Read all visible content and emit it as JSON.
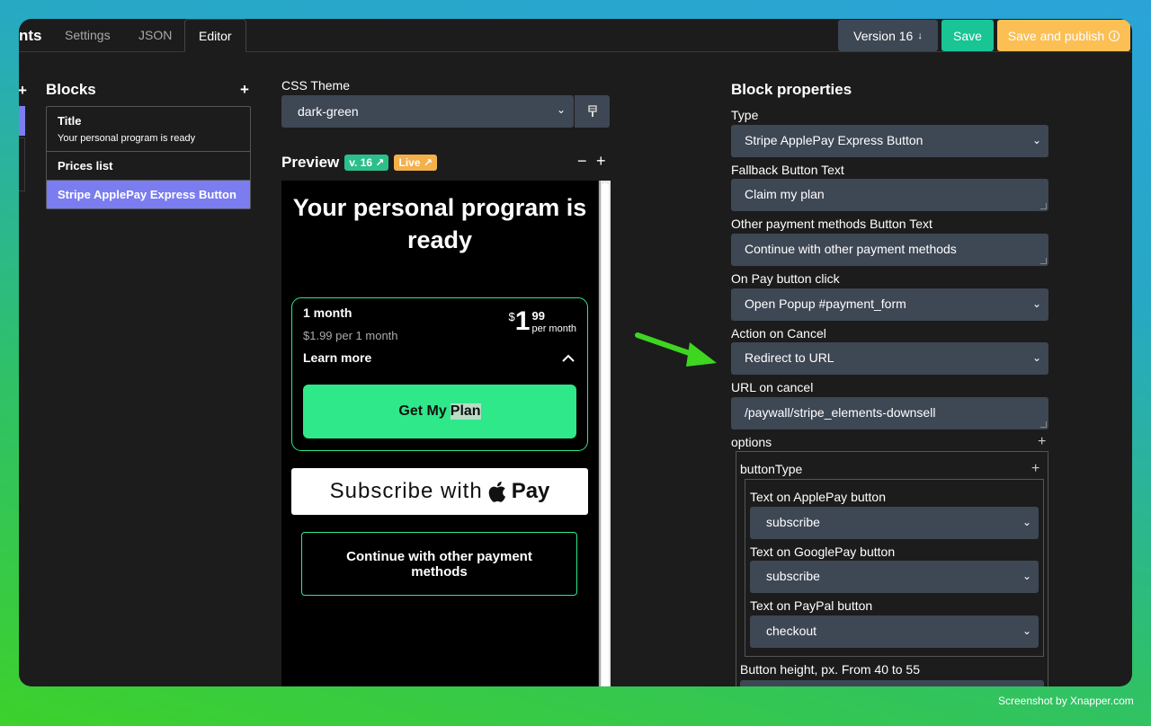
{
  "header": {
    "brand_partial": "nts",
    "tabs": [
      "Settings",
      "JSON",
      "Editor"
    ],
    "version_label": "Version 16",
    "save_label": "Save",
    "publish_label": "Save and publish"
  },
  "sidebar": {
    "title": "Blocks",
    "items": [
      {
        "title": "Title",
        "subtitle": "Your personal program is ready"
      },
      {
        "title": "Prices list"
      },
      {
        "title": "Stripe ApplePay Express Button"
      }
    ]
  },
  "theme": {
    "label": "CSS Theme",
    "value": "dark-green"
  },
  "preview": {
    "title": "Preview",
    "version_badge": "v. 16",
    "live_badge": "Live",
    "page_title": "Your personal program is ready",
    "plan": {
      "name": "1 month",
      "sub": "$1.99 per 1 month",
      "currency": "$",
      "price_int": "1",
      "price_cents": "99",
      "per": "per month",
      "learn_more": "Learn more",
      "cta_pre": "Get My",
      "cta_hl": "Plan"
    },
    "apple_pay_text": "Subscribe with",
    "apple_pay_word": "Pay",
    "other_methods": "Continue with other payment methods"
  },
  "props": {
    "title": "Block properties",
    "type_label": "Type",
    "type_value": "Stripe ApplePay Express Button",
    "fallback_label": "Fallback Button Text",
    "fallback_value": "Claim my plan",
    "other_label": "Other payment methods Button Text",
    "other_value": "Continue with other payment methods",
    "onpay_label": "On Pay button click",
    "onpay_value": "Open Popup #payment_form",
    "cancel_label": "Action on Cancel",
    "cancel_value": "Redirect to URL",
    "url_label": "URL on cancel",
    "url_value": "/paywall/stripe_elements-downsell",
    "options_label": "options",
    "button_type_label": "buttonType",
    "applepay_label": "Text on ApplePay button",
    "applepay_value": "subscribe",
    "googlepay_label": "Text on GooglePay button",
    "googlepay_value": "subscribe",
    "paypal_label": "Text on PayPal button",
    "paypal_value": "checkout",
    "height_label": "Button height, px. From 40 to 55"
  },
  "credit": "Screenshot by Xnapper.com"
}
